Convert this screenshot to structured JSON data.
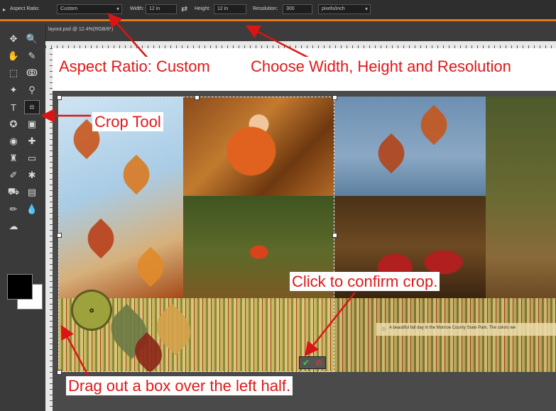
{
  "options_bar": {
    "aspect_ratio_label": "Aspect Ratio:",
    "aspect_ratio_value": "Custom",
    "width_label": "Width:",
    "width_value": "12 in",
    "swap_icon": "swap-arrows-icon",
    "height_label": "Height:",
    "height_value": "12 in",
    "resolution_label": "Resolution:",
    "resolution_value": "300",
    "units_value": "pixels/inch"
  },
  "document": {
    "tab_title": "layout.psd @ 12.4%(RGB/8*)"
  },
  "toolbox": {
    "tools": [
      {
        "name": "move-tool-icon",
        "glyph": "✥"
      },
      {
        "name": "zoom-tool-icon",
        "glyph": "🔍"
      },
      {
        "name": "hand-tool-icon",
        "glyph": "✋"
      },
      {
        "name": "eyedropper-tool-icon",
        "glyph": "✎"
      },
      {
        "name": "marquee-tool-icon",
        "glyph": "⬚"
      },
      {
        "name": "lasso-tool-icon",
        "glyph": "ↂ"
      },
      {
        "name": "magic-wand-tool-icon",
        "glyph": "✦"
      },
      {
        "name": "quick-selection-tool-icon",
        "glyph": "⚲"
      },
      {
        "name": "type-tool-icon",
        "glyph": "T"
      },
      {
        "name": "crop-tool-icon",
        "glyph": "⌗"
      },
      {
        "name": "custom-shape-tool-icon",
        "glyph": "✪"
      },
      {
        "name": "recompose-tool-icon",
        "glyph": "▣"
      },
      {
        "name": "red-eye-tool-icon",
        "glyph": "◉"
      },
      {
        "name": "healing-brush-tool-icon",
        "glyph": "✚"
      },
      {
        "name": "clone-stamp-tool-icon",
        "glyph": "♜"
      },
      {
        "name": "eraser-tool-icon",
        "glyph": "▭"
      },
      {
        "name": "brush-tool-icon",
        "glyph": "✐"
      },
      {
        "name": "smart-brush-tool-icon",
        "glyph": "✱"
      },
      {
        "name": "paint-bucket-tool-icon",
        "glyph": "⛟"
      },
      {
        "name": "gradient-tool-icon",
        "glyph": "▤"
      },
      {
        "name": "pencil-tool-icon",
        "glyph": "✏"
      },
      {
        "name": "blur-tool-icon",
        "glyph": "💧"
      },
      {
        "name": "sponge-tool-icon",
        "glyph": "☁"
      }
    ],
    "foreground_color": "#000000",
    "background_color": "#ffffff"
  },
  "canvas": {
    "caption_text": "A beautiful fall day in the Monroe County State Park.  The colors we"
  },
  "annotations": {
    "aspect_ratio_callout": "Aspect Ratio: Custom",
    "dimensions_callout": "Choose Width, Height and Resolution",
    "crop_tool_callout": "Crop Tool",
    "confirm_callout": "Click to confirm crop.",
    "drag_callout": "Drag out a box over the left half.",
    "annotation_color": "#e01818",
    "accent_color": "#e07a1f"
  },
  "commit": {
    "confirm_icon": "checkmark-icon",
    "cancel_icon": "cancel-icon"
  }
}
